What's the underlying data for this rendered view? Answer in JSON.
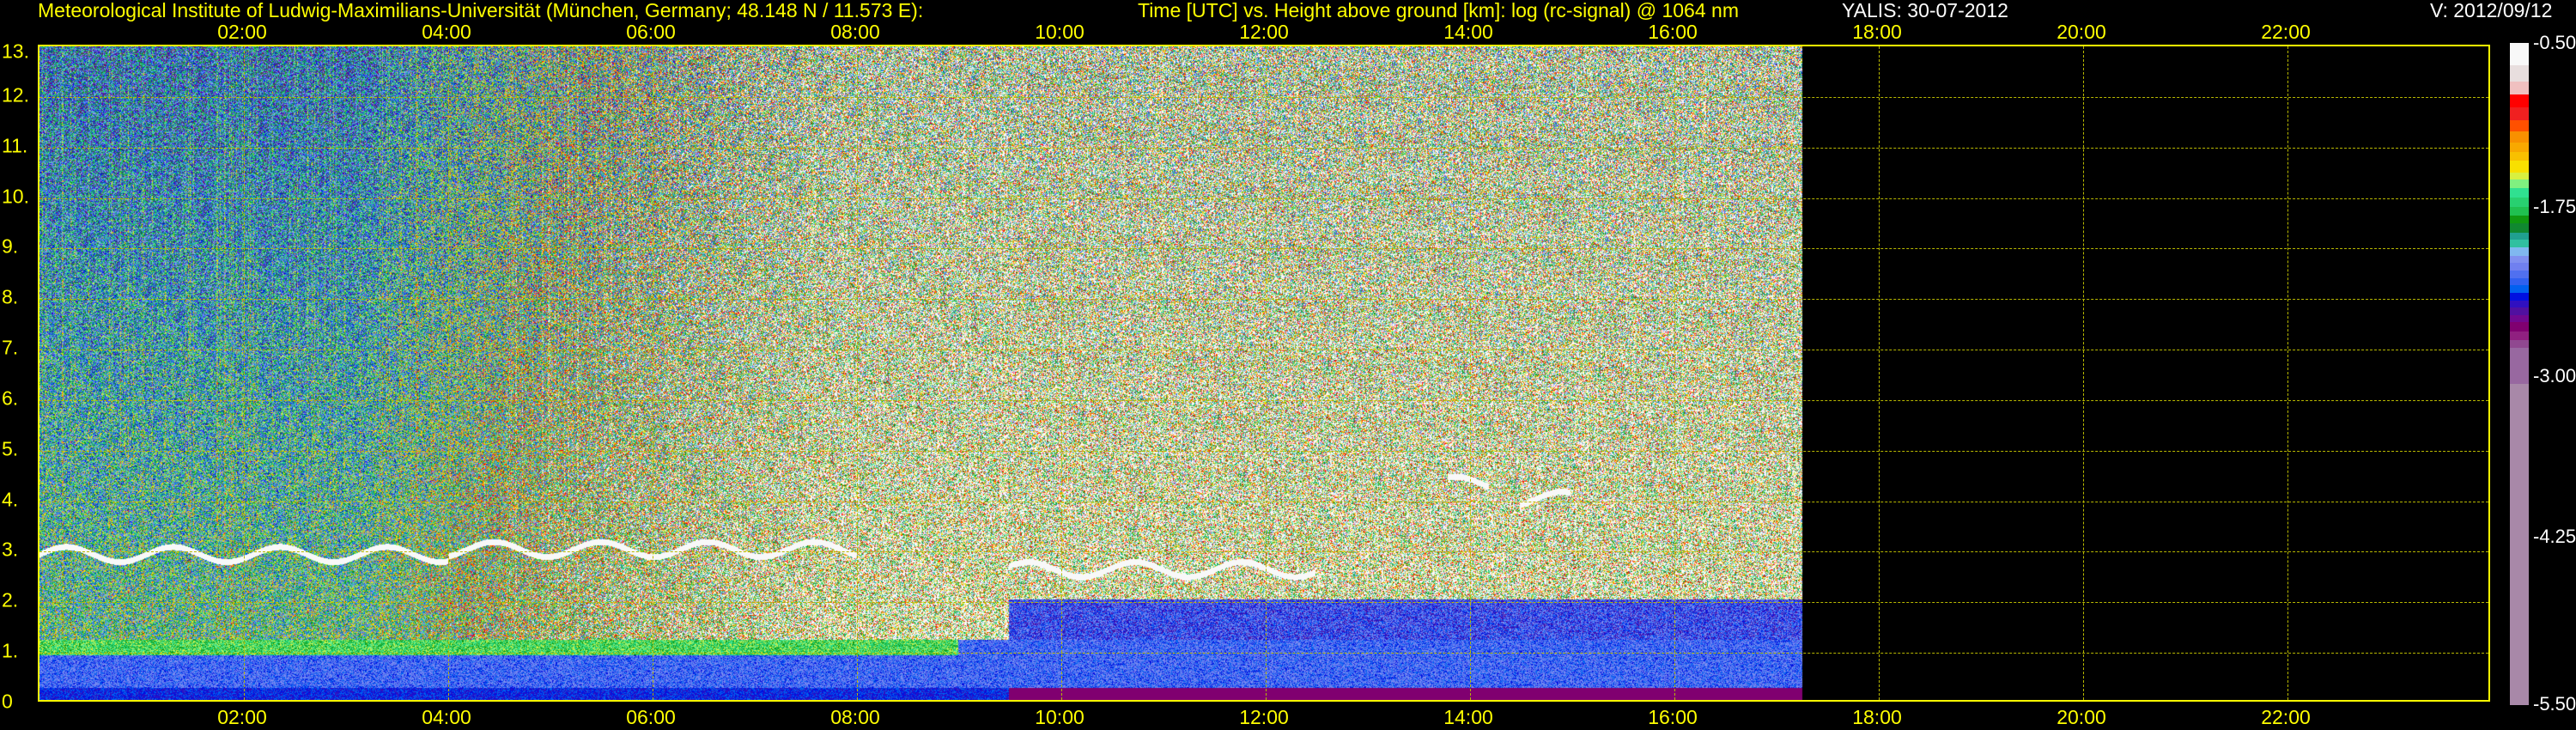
{
  "header": {
    "institute": "Meteorological Institute of Ludwig-Maximilians-Universität (München, Germany; 48.148 N / 11.573 E):",
    "plot_title": "Time [UTC] vs. Height above ground [km]: log (rc-signal) @ 1064 nm",
    "instrument_date": "YALIS: 30-07-2012",
    "version": "V: 2012/09/12"
  },
  "chart_data": {
    "type": "heatmap",
    "title": "Time [UTC] vs. Height above ground [km]: log (rc-signal) @ 1064 nm",
    "xlabel": "Time [UTC]",
    "ylabel": "Height above ground [km]",
    "xlim": [
      0,
      24
    ],
    "ylim": [
      0,
      13
    ],
    "data_end_hour": 17.28,
    "x_ticks": [
      "02:00",
      "04:00",
      "06:00",
      "08:00",
      "10:00",
      "12:00",
      "14:00",
      "16:00",
      "18:00",
      "20:00",
      "22:00"
    ],
    "x_tick_values": [
      2,
      4,
      6,
      8,
      10,
      12,
      14,
      16,
      18,
      20,
      22
    ],
    "y_ticks": [
      "0",
      "1.",
      "2.",
      "3.",
      "4.",
      "5.",
      "6.",
      "7.",
      "8.",
      "9.",
      "10.",
      "11.",
      "12.",
      "13."
    ],
    "y_tick_values": [
      0,
      1,
      2,
      3,
      4,
      5,
      6,
      7,
      8,
      9,
      10,
      11,
      12,
      13
    ],
    "grid": true,
    "colorbar": {
      "ticks": [
        "-0.50",
        "-1.75",
        "-3.00",
        "-4.25",
        "-5.50"
      ],
      "tick_values": [
        -0.5,
        -1.75,
        -3.0,
        -4.25,
        -5.5
      ],
      "colors": [
        "#f8f8f8",
        "#e8dede",
        "#f0c0c0",
        "#ff0000",
        "#f02020",
        "#ff5000",
        "#f89000",
        "#f8a800",
        "#f8c000",
        "#f8e000",
        "#d8f040",
        "#80f080",
        "#30e090",
        "#28d070",
        "#20c050",
        "#109810",
        "#108830",
        "#20a090",
        "#30c0a0",
        "#80b8f0",
        "#8090f0",
        "#7080f0",
        "#5070f0",
        "#3060f0",
        "#0060f0",
        "#0010e0",
        "#3010c0",
        "#5010a0",
        "#700890",
        "#800070",
        "#902080",
        "#904890",
        "#9868a0",
        "#a888a8"
      ]
    },
    "cloud_layers": [
      {
        "start": 0.0,
        "end": 4.0,
        "height_km": 2.9
      },
      {
        "start": 4.0,
        "end": 8.0,
        "height_km": 3.0
      },
      {
        "start": 9.5,
        "end": 12.5,
        "height_km": 2.6
      },
      {
        "start": 13.8,
        "end": 14.2,
        "height_km": 4.3
      },
      {
        "start": 14.5,
        "end": 15.0,
        "height_km": 4.0
      }
    ],
    "boundary_layer_top_km": 1.2
  }
}
